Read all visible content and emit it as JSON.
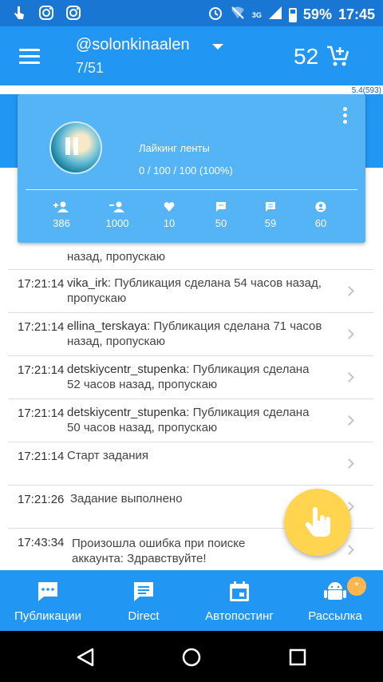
{
  "status_bar": {
    "battery": "59%",
    "time": "17:45",
    "network": "3G"
  },
  "app_bar": {
    "account": "@solonkinaalen",
    "counter": "7/51",
    "credits": "52"
  },
  "version": "5.4(593)",
  "card": {
    "title": "Лайкинг ленты",
    "progress": "0 / 100 / 100 (100%)",
    "stats": [
      {
        "icon": "follow-icon",
        "value": "386"
      },
      {
        "icon": "unfollow-icon",
        "value": "1000"
      },
      {
        "icon": "heart-icon",
        "value": "10"
      },
      {
        "icon": "comment-icon",
        "value": "50"
      },
      {
        "icon": "message-icon",
        "value": "59"
      },
      {
        "icon": "profile-icon",
        "value": "60"
      }
    ]
  },
  "log": [
    {
      "time": "",
      "user": "",
      "text": "назад, пропускаю"
    },
    {
      "time": "17:21:14",
      "user": "vika_irk",
      "text": ": Публикация сделана 54 часов назад, пропускаю"
    },
    {
      "time": "17:21:14",
      "user": "ellina_terskaya",
      "text": ": Публикация сделана 71 часов назад, пропускаю"
    },
    {
      "time": "17:21:14",
      "user": "detskiycentr_stupenka",
      "text": ": Публикация сделана 52 часов назад, пропускаю"
    },
    {
      "time": "17:21:14",
      "user": "detskiycentr_stupenka",
      "text": ": Публикация сделана 50 часов назад, пропускаю"
    },
    {
      "time": "17:21:14",
      "user": "",
      "text": "Старт задания"
    },
    {
      "time": "17:21:26",
      "user": "",
      "text": "Задание выполнено"
    },
    {
      "time": "17:43:34",
      "user": "",
      "text": "Произошла ошибка при поиске аккаунта: Здравствуйте!"
    }
  ],
  "bottom_nav": [
    {
      "label": "Публикации",
      "icon": "publications-icon"
    },
    {
      "label": "Direct",
      "icon": "direct-icon"
    },
    {
      "label": "Автопостинг",
      "icon": "calendar-icon"
    },
    {
      "label": "Рассылка",
      "icon": "android-icon"
    }
  ],
  "badge": "*",
  "colors": {
    "primary": "#2196F3",
    "primary_dark": "#1976D2",
    "card": "#54B4F5",
    "fab": "#FFD54F",
    "badge": "#FFB74D"
  }
}
